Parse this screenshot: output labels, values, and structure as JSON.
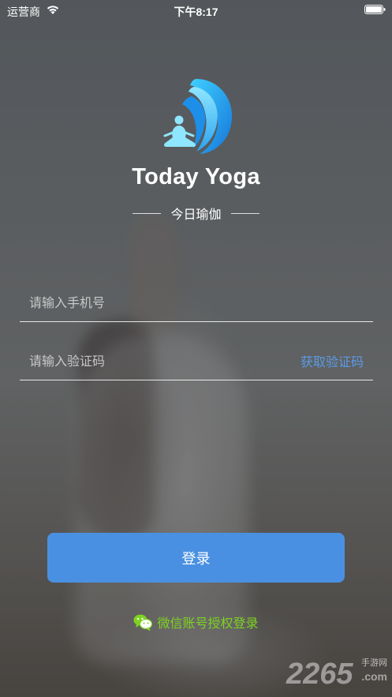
{
  "status_bar": {
    "carrier": "运营商",
    "time": "下午8:17",
    "wifi_icon": "wifi-icon",
    "battery_icon": "battery-icon"
  },
  "app": {
    "logo_icon": "yoga-meditation-logo-icon",
    "title": "Today Yoga",
    "subtitle": "今日瑜伽"
  },
  "form": {
    "phone_placeholder": "请输入手机号",
    "phone_value": "",
    "code_placeholder": "请输入验证码",
    "code_value": "",
    "get_code_label": "获取验证码",
    "login_label": "登录"
  },
  "wechat": {
    "icon": "wechat-icon",
    "label": "微信账号授权登录"
  },
  "colors": {
    "accent_blue": "#4a90e2",
    "link_blue": "#5b9be6",
    "wechat_green": "#7ed321"
  },
  "watermark": {
    "number": "2265",
    "site_cn": "手游网",
    "domain": ".com"
  }
}
